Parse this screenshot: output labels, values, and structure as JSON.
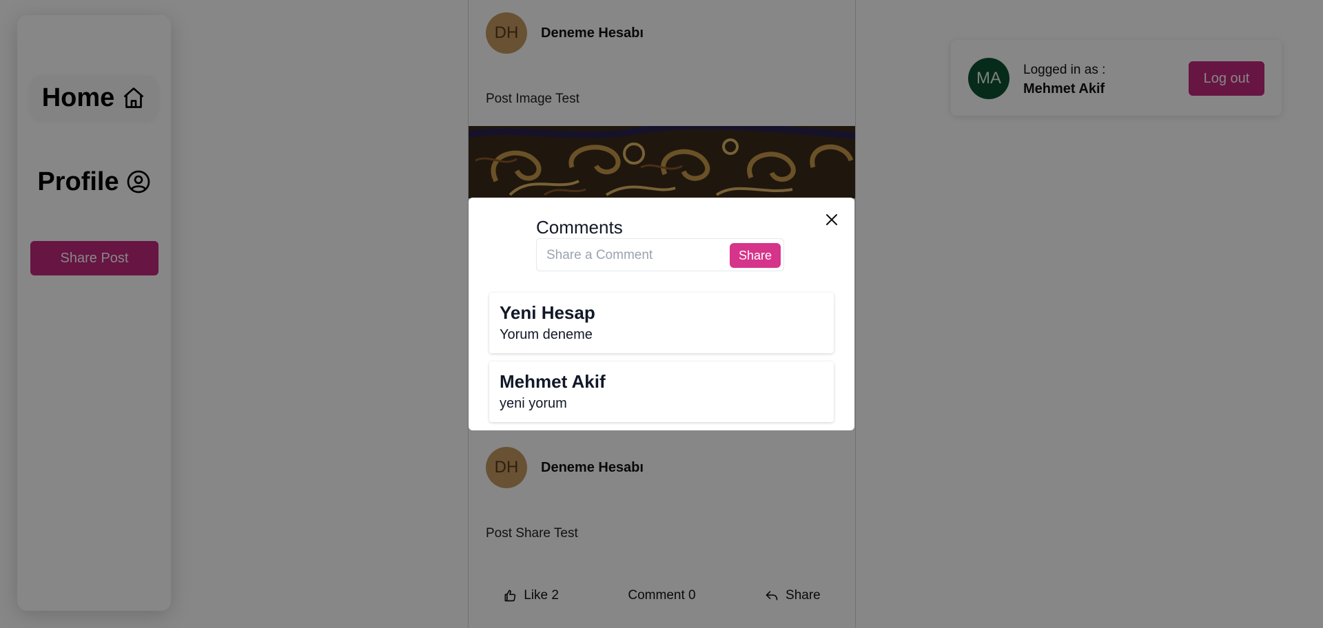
{
  "sidebar": {
    "home_label": "Home",
    "profile_label": "Profile",
    "share_post_label": "Share Post"
  },
  "feed": {
    "posts": [
      {
        "avatar_initials": "DH",
        "author": "Deneme Hesabı",
        "text": "Post Image Test",
        "has_image": true
      },
      {
        "avatar_initials": "DH",
        "author": "Deneme Hesabı",
        "text": "Post Share Test",
        "actions": {
          "like_label": "Like 2",
          "comment_label": "Comment 0",
          "share_label": "Share"
        }
      }
    ]
  },
  "user": {
    "avatar_initials": "MA",
    "logged_label": "Logged in as :",
    "name": "Mehmet Akif",
    "logout_label": "Log out"
  },
  "modal": {
    "title": "Comments",
    "input_placeholder": "Share a Comment",
    "input_value": "",
    "share_label": "Share",
    "comments": [
      {
        "author": "Yeni Hesap",
        "text": "Yorum deneme"
      },
      {
        "author": "Mehmet Akif",
        "text": "yeni yorum"
      }
    ]
  },
  "colors": {
    "accent": "#c2287f",
    "accent_light": "#d6338a",
    "avatar_dh": "#c69a63",
    "avatar_ma": "#0f5132",
    "overlay": "rgba(0,0,0,0.47)"
  }
}
